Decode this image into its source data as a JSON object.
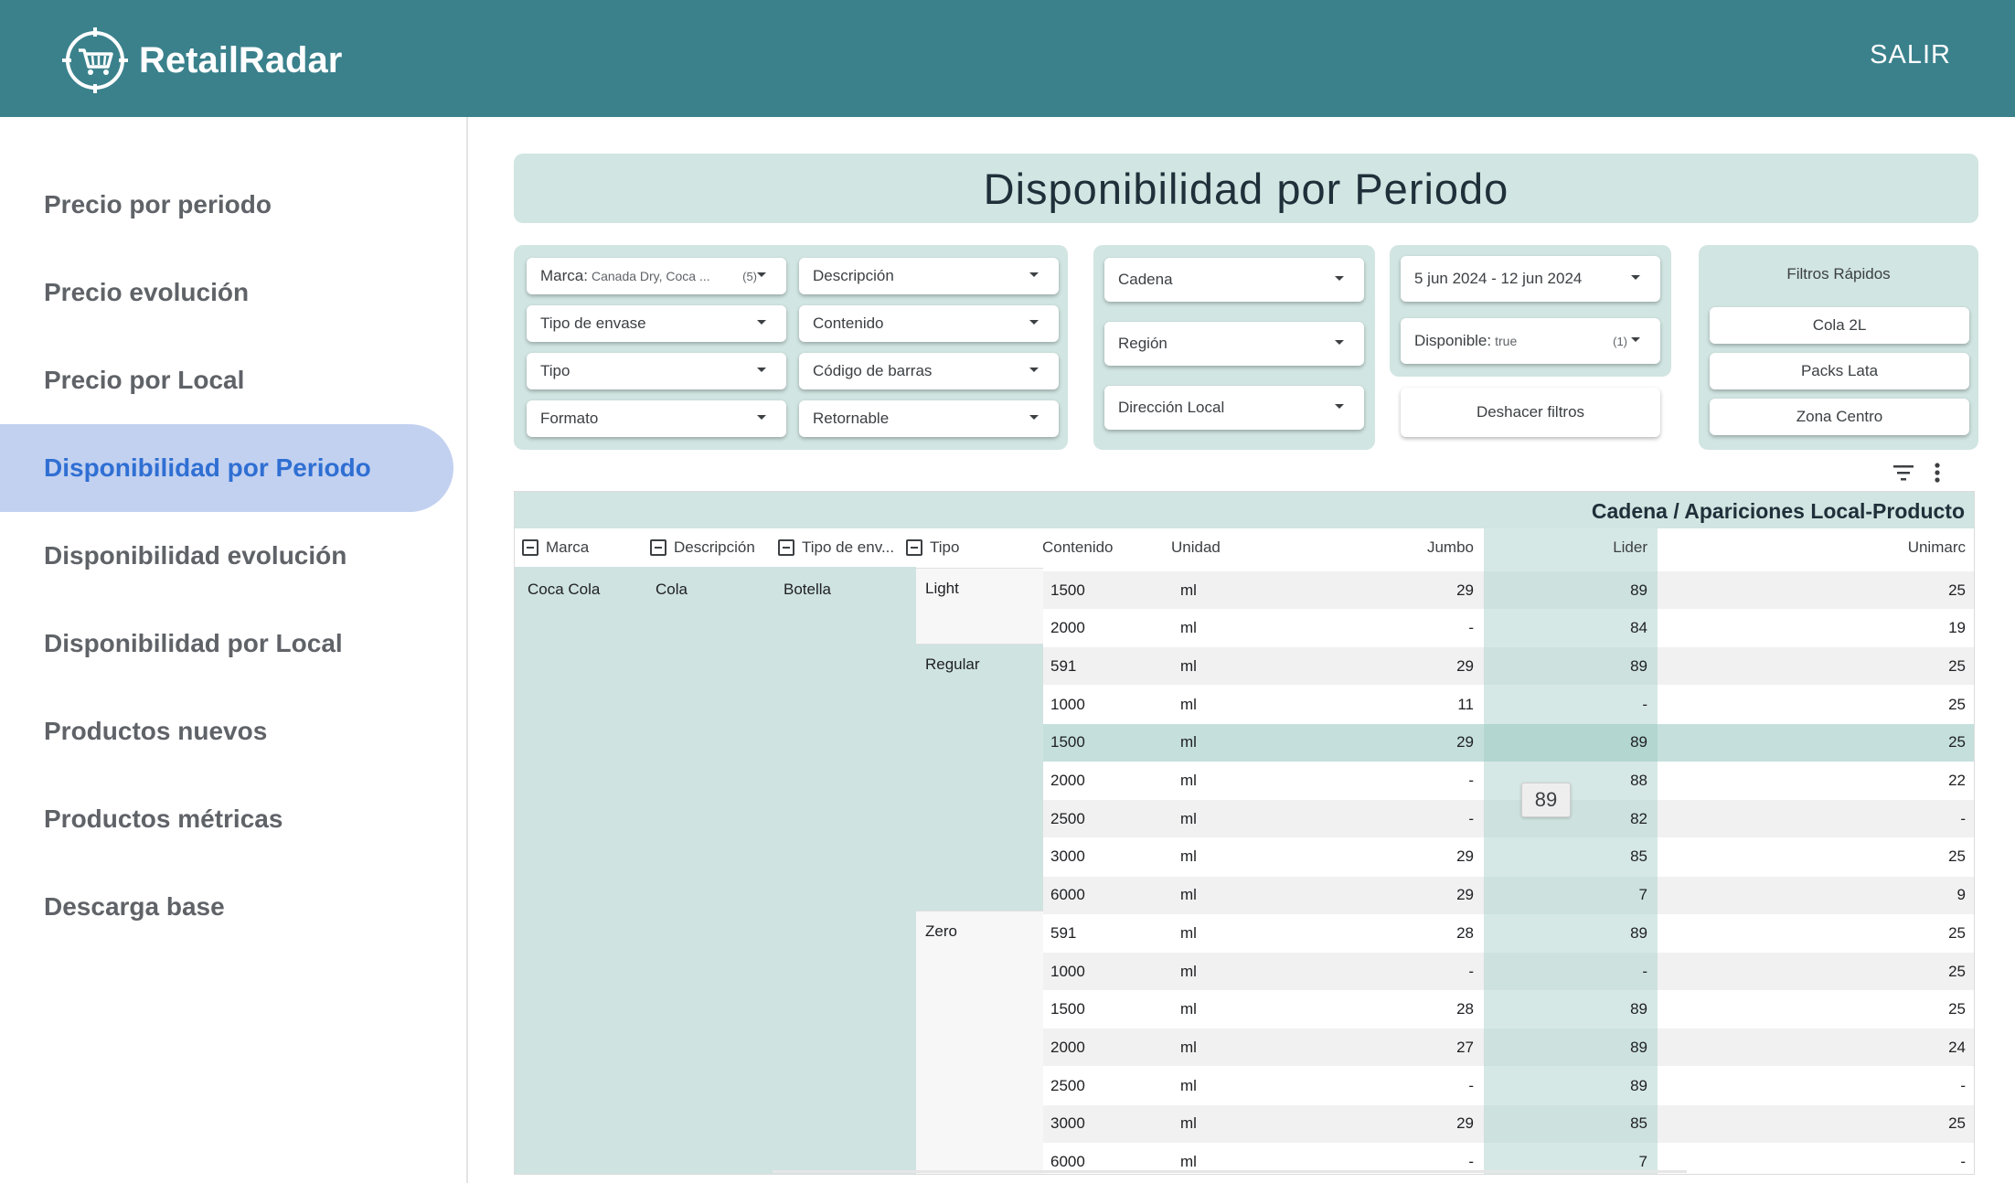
{
  "app": {
    "name": "RetailRadar",
    "logout_label": "SALIR",
    "brand_color": "#3a818c",
    "accent_color": "#2f6fd3"
  },
  "sidebar": {
    "items": [
      {
        "label": "Precio por periodo",
        "active": false
      },
      {
        "label": "Precio evolución",
        "active": false
      },
      {
        "label": "Precio por Local",
        "active": false
      },
      {
        "label": "Disponibilidad por Periodo",
        "active": true
      },
      {
        "label": "Disponibilidad evolución",
        "active": false
      },
      {
        "label": "Disponibilidad por Local",
        "active": false
      },
      {
        "label": "Productos nuevos",
        "active": false
      },
      {
        "label": "Productos métricas",
        "active": false
      },
      {
        "label": "Descarga base",
        "active": false
      }
    ]
  },
  "page": {
    "title": "Disponibilidad por Periodo"
  },
  "filters": {
    "marca": {
      "label": "Marca",
      "value": "Canada Dry, Coca ...",
      "count": "(5)"
    },
    "descripcion": {
      "label": "Descripción"
    },
    "tipo_envase": {
      "label": "Tipo de envase"
    },
    "contenido": {
      "label": "Contenido"
    },
    "tipo": {
      "label": "Tipo"
    },
    "codigo_barras": {
      "label": "Código de barras"
    },
    "formato": {
      "label": "Formato"
    },
    "retornable": {
      "label": "Retornable"
    },
    "cadena": {
      "label": "Cadena"
    },
    "region": {
      "label": "Región"
    },
    "direccion_local": {
      "label": "Dirección Local"
    },
    "date_range": {
      "label": "5 jun 2024 - 12 jun 2024"
    },
    "disponible": {
      "label": "Disponible",
      "value": "true",
      "count": "(1)"
    },
    "reset_label": "Deshacer filtros",
    "quick": {
      "title": "Filtros Rápidos",
      "buttons": [
        "Cola 2L",
        "Packs Lata",
        "Zona Centro"
      ]
    }
  },
  "table": {
    "title": "Cadena / Apariciones Local-Producto",
    "headers": {
      "marca": "Marca",
      "descripcion": "Descripción",
      "tipo_envase": "Tipo de env...",
      "tipo": "Tipo",
      "contenido": "Contenido",
      "unidad": "Unidad",
      "jumbo": "Jumbo",
      "lider": "Lider",
      "unimarc": "Unimarc"
    },
    "group": {
      "marca": "Coca Cola",
      "descripcion": "Cola",
      "tipo_envase": "Botella"
    },
    "tipos": [
      "Light",
      "Regular",
      "Zero"
    ],
    "rows": [
      {
        "tipo": "Light",
        "contenido": "1500",
        "unidad": "ml",
        "jumbo": "29",
        "lider": "89",
        "unimarc": "25"
      },
      {
        "tipo": "",
        "contenido": "2000",
        "unidad": "ml",
        "jumbo": "-",
        "lider": "84",
        "unimarc": "19"
      },
      {
        "tipo": "Regular",
        "contenido": "591",
        "unidad": "ml",
        "jumbo": "29",
        "lider": "89",
        "unimarc": "25"
      },
      {
        "tipo": "",
        "contenido": "1000",
        "unidad": "ml",
        "jumbo": "11",
        "lider": "-",
        "unimarc": "25"
      },
      {
        "tipo": "",
        "contenido": "1500",
        "unidad": "ml",
        "jumbo": "29",
        "lider": "89",
        "unimarc": "25"
      },
      {
        "tipo": "",
        "contenido": "2000",
        "unidad": "ml",
        "jumbo": "-",
        "lider": "88",
        "unimarc": "22"
      },
      {
        "tipo": "",
        "contenido": "2500",
        "unidad": "ml",
        "jumbo": "-",
        "lider": "82",
        "unimarc": "-"
      },
      {
        "tipo": "",
        "contenido": "3000",
        "unidad": "ml",
        "jumbo": "29",
        "lider": "85",
        "unimarc": "25"
      },
      {
        "tipo": "",
        "contenido": "6000",
        "unidad": "ml",
        "jumbo": "29",
        "lider": "7",
        "unimarc": "9"
      },
      {
        "tipo": "Zero",
        "contenido": "591",
        "unidad": "ml",
        "jumbo": "28",
        "lider": "89",
        "unimarc": "25"
      },
      {
        "tipo": "",
        "contenido": "1000",
        "unidad": "ml",
        "jumbo": "-",
        "lider": "-",
        "unimarc": "25"
      },
      {
        "tipo": "",
        "contenido": "1500",
        "unidad": "ml",
        "jumbo": "28",
        "lider": "89",
        "unimarc": "25"
      },
      {
        "tipo": "",
        "contenido": "2000",
        "unidad": "ml",
        "jumbo": "27",
        "lider": "89",
        "unimarc": "24"
      },
      {
        "tipo": "",
        "contenido": "2500",
        "unidad": "ml",
        "jumbo": "-",
        "lider": "89",
        "unimarc": "-"
      },
      {
        "tipo": "",
        "contenido": "3000",
        "unidad": "ml",
        "jumbo": "29",
        "lider": "85",
        "unimarc": "25"
      },
      {
        "tipo": "",
        "contenido": "6000",
        "unidad": "ml",
        "jumbo": "-",
        "lider": "7",
        "unimarc": "-"
      }
    ],
    "hovered_row_index": 4,
    "tooltip_value": "89"
  }
}
